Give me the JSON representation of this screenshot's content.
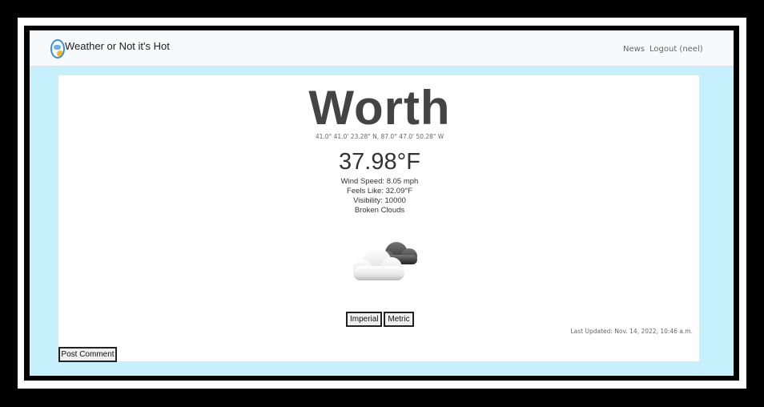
{
  "navbar": {
    "brand": "Weather or Not it's Hot",
    "news": "News",
    "logout": "Logout (neel)"
  },
  "weather": {
    "city": "Worth",
    "coordinates": "41.0° 41.0' 23.28\" N, 87.0° 47.0' 50.28\" W",
    "temperature": "37.98°F",
    "wind_speed": "Wind Speed: 8.05 mph",
    "feels_like": "Feels Like: 32.09°F",
    "visibility": "Visibility: 10000",
    "description": "Broken Clouds",
    "icon": "broken-clouds-icon"
  },
  "units": {
    "imperial": "Imperial",
    "metric": "Metric"
  },
  "last_updated": "Last Updated: Nov. 14, 2022, 10:46 a.m.",
  "post_comment": "Post Comment"
}
